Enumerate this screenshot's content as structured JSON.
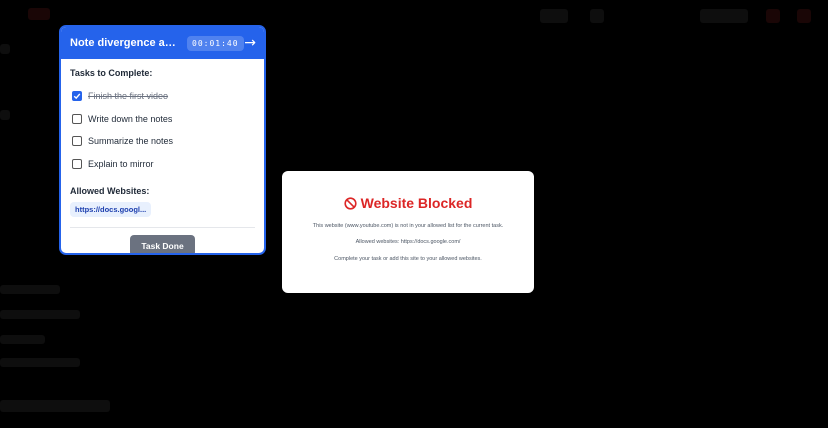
{
  "task_panel": {
    "title": "Note divergence and c...",
    "timer": "00:01:40",
    "arrow_icon": "arrow-right-icon",
    "tasks_heading": "Tasks to Complete:",
    "tasks": [
      {
        "label": "Finish the first video",
        "checked": true
      },
      {
        "label": "Write down the notes",
        "checked": false
      },
      {
        "label": "Summarize the notes",
        "checked": false
      },
      {
        "label": "Explain to mirror",
        "checked": false
      }
    ],
    "allowed_heading": "Allowed Websites:",
    "allowed_sites": [
      "https://docs.googl..."
    ],
    "done_label": "Task Done"
  },
  "blocked_modal": {
    "icon": "prohibited-icon",
    "title": "Website Blocked",
    "message": "This website (www.youtube.com) is not in your allowed list for the current task.",
    "allowed_line": "Allowed websites: https://docs.google.com/",
    "hint": "Complete your task or add this site to your allowed websites."
  },
  "colors": {
    "accent": "#2563eb",
    "danger": "#dc2626",
    "background": "#000000"
  }
}
